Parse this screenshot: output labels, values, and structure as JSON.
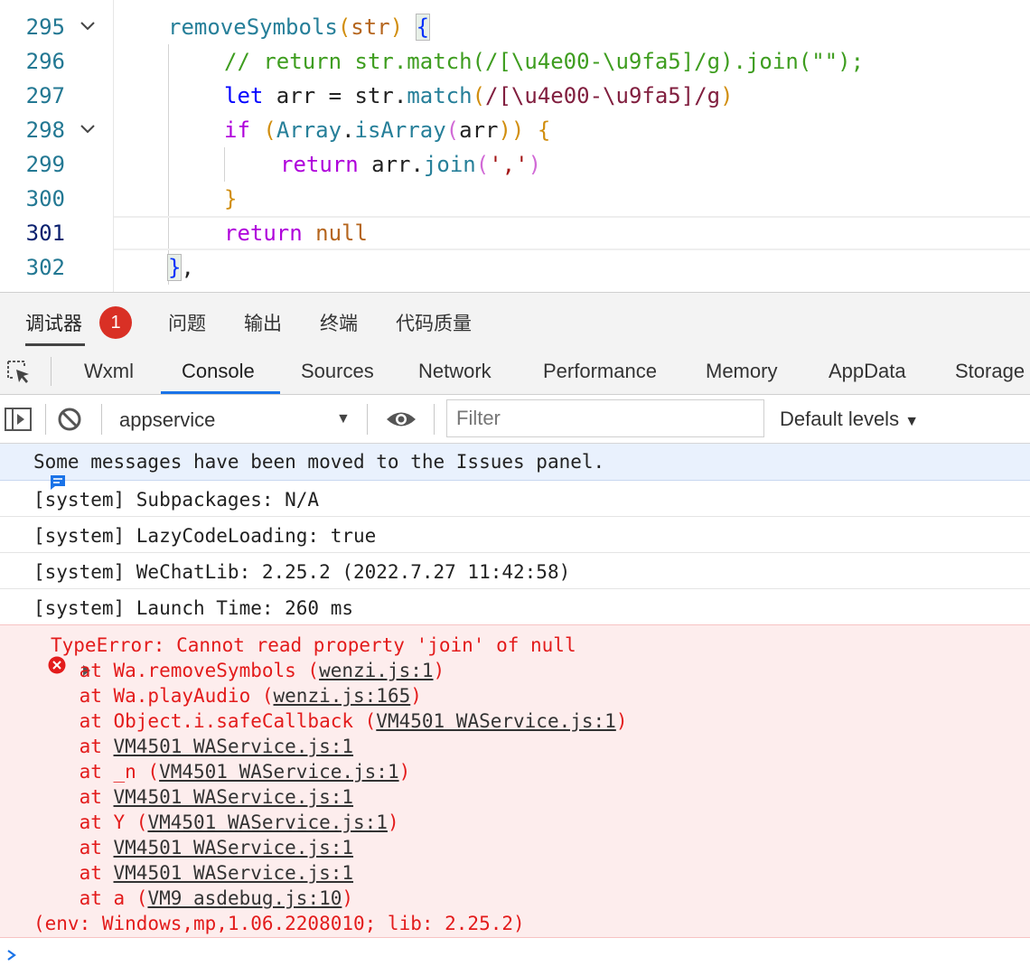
{
  "editor": {
    "line_numbers": [
      "295",
      "296",
      "297",
      "298",
      "299",
      "300",
      "301",
      "302"
    ],
    "active_line": "301",
    "lines": {
      "l295": {
        "fn": "removeSymbols",
        "p1": "(",
        "param": "str",
        "p2": ")",
        "brace": "{"
      },
      "l296": {
        "comment": "// return str.match(/[\\u4e00-\\u9fa5]/g).join(\"\");"
      },
      "l297": {
        "let": "let",
        "var": " arr = str.",
        "method": "match",
        "p1": "(",
        "regex": "/[\\u4e00-\\u9fa5]/g",
        "p2": ")"
      },
      "l298": {
        "kw": "if",
        "p1": " (",
        "cls": "Array",
        "dot": ".",
        "method": "isArray",
        "p2": "(",
        "var": "arr",
        "p3": "))",
        "brace": " {"
      },
      "l299": {
        "kw": "return",
        "var": " arr.",
        "method": "join",
        "p1": "(",
        "str": "','",
        "p2": ")"
      },
      "l300": {
        "brace": "}"
      },
      "l301": {
        "kw": "return",
        "null": " null"
      },
      "l302": {
        "brace": "}",
        "comma": ","
      }
    }
  },
  "panel_tabs": {
    "debugger": "调试器",
    "badge": "1",
    "problems": "问题",
    "output": "输出",
    "terminal": "终端",
    "code_quality": "代码质量"
  },
  "devtools_tabs": [
    "Wxml",
    "Console",
    "Sources",
    "Network",
    "Performance",
    "Memory",
    "AppData",
    "Storage"
  ],
  "active_tab": "Console",
  "toolbar": {
    "context": "appservice",
    "filter_placeholder": "Filter",
    "levels": "Default levels"
  },
  "console": {
    "info_message": "Some messages have been moved to the Issues panel.",
    "system_lines": [
      "[system] Subpackages: N/A",
      "[system] LazyCodeLoading: true",
      "[system] WeChatLib: 2.25.2 (2022.7.27 11:42:58)",
      "[system] Launch Time: 260 ms"
    ],
    "error": {
      "message": "TypeError: Cannot read property 'join' of null",
      "stack": [
        {
          "pre": "    at Wa.removeSymbols (",
          "link": "wenzi.js:1",
          "post": ")"
        },
        {
          "pre": "    at Wa.playAudio (",
          "link": "wenzi.js:165",
          "post": ")"
        },
        {
          "pre": "    at Object.i.safeCallback (",
          "link": "VM4501 WAService.js:1",
          "post": ")"
        },
        {
          "pre": "    at ",
          "link": "VM4501 WAService.js:1",
          "post": ""
        },
        {
          "pre": "    at _n (",
          "link": "VM4501 WAService.js:1",
          "post": ")"
        },
        {
          "pre": "    at ",
          "link": "VM4501 WAService.js:1",
          "post": ""
        },
        {
          "pre": "    at Y (",
          "link": "VM4501 WAService.js:1",
          "post": ")"
        },
        {
          "pre": "    at ",
          "link": "VM4501 WAService.js:1",
          "post": ""
        },
        {
          "pre": "    at ",
          "link": "VM4501 WAService.js:1",
          "post": ""
        },
        {
          "pre": "    at a (",
          "link": "VM9 asdebug.js:10",
          "post": ")"
        }
      ],
      "env": "(env: Windows,mp,1.06.2208010; lib: 2.25.2)"
    }
  },
  "colors": {
    "error": "#e31b1b",
    "accent": "#1a73e8",
    "badge": "#d93025"
  }
}
